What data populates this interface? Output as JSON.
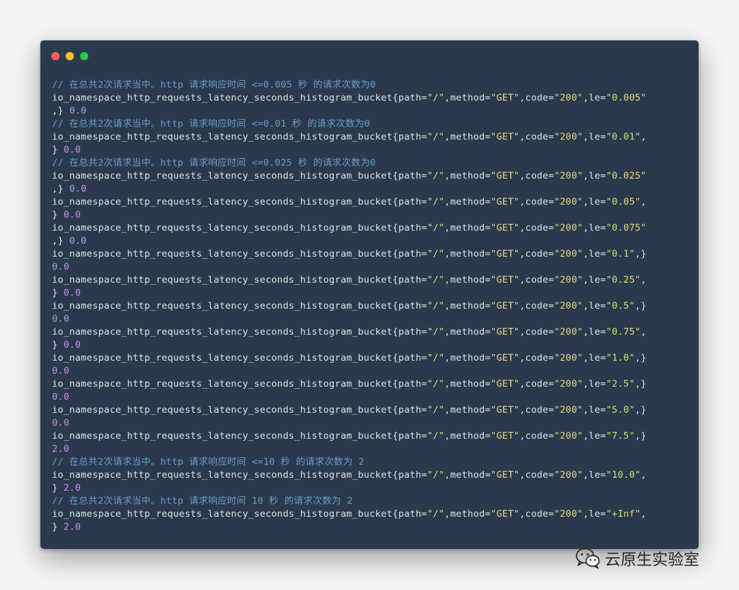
{
  "window": {
    "buttons": {
      "close": "#ff5f56",
      "minimize": "#ffbd2e",
      "zoom": "#27c93f"
    }
  },
  "code": {
    "metric": "io_namespace_http_requests_latency_seconds_histogram_bucket",
    "path_key": "path=",
    "path_value": "\"/\"",
    "method_key": ",method=",
    "method_value": "\"GET\"",
    "code_key": ",code=",
    "code_value": "\"200\"",
    "le_key": ",le=",
    "lines": [
      {
        "kind": "comment",
        "text": "// 在总共2次请求当中。http 请求响应时间 <=0.005 秒 的请求次数为0"
      },
      {
        "kind": "bucket",
        "le": "\"0.005\"",
        "tail": "",
        "wrap_prefix": ",} ",
        "value": "0.0"
      },
      {
        "kind": "comment",
        "text": "// 在总共2次请求当中。http 请求响应时间 <=0.01 秒 的请求次数为0"
      },
      {
        "kind": "bucket",
        "le": "\"0.01\"",
        "tail": ",",
        "wrap_prefix": "} ",
        "value": "0.0"
      },
      {
        "kind": "comment",
        "text": "// 在总共2次请求当中。http 请求响应时间 <=0.025 秒 的请求次数为0"
      },
      {
        "kind": "bucket",
        "le": "\"0.025\"",
        "tail": "",
        "wrap_prefix": ",} ",
        "value": "0.0"
      },
      {
        "kind": "bucket",
        "le": "\"0.05\"",
        "tail": ",",
        "wrap_prefix": "} ",
        "value": "0.0"
      },
      {
        "kind": "bucket",
        "le": "\"0.075\"",
        "tail": "",
        "wrap_prefix": ",} ",
        "value": "0.0"
      },
      {
        "kind": "bucket",
        "le": "\"0.1\"",
        "tail": ",}",
        "wrap_prefix": "",
        "value": "0.0"
      },
      {
        "kind": "bucket",
        "le": "\"0.25\"",
        "tail": ",",
        "wrap_prefix": "} ",
        "value": "0.0"
      },
      {
        "kind": "bucket",
        "le": "\"0.5\"",
        "tail": ",}",
        "wrap_prefix": "",
        "value": "0.0"
      },
      {
        "kind": "bucket",
        "le": "\"0.75\"",
        "tail": ",",
        "wrap_prefix": "} ",
        "value": "0.0"
      },
      {
        "kind": "bucket",
        "le": "\"1.0\"",
        "tail": ",}",
        "wrap_prefix": "",
        "value": "0.0"
      },
      {
        "kind": "bucket",
        "le": "\"2.5\"",
        "tail": ",}",
        "wrap_prefix": "",
        "value": "0.0"
      },
      {
        "kind": "bucket",
        "le": "\"5.0\"",
        "tail": ",}",
        "wrap_prefix": "",
        "value": "0.0"
      },
      {
        "kind": "bucket",
        "le": "\"7.5\"",
        "tail": ",}",
        "wrap_prefix": "",
        "value": "2.0"
      },
      {
        "kind": "comment",
        "text": "// 在总共2次请求当中。http 请求响应时间 <=10 秒 的请求次数为 2"
      },
      {
        "kind": "bucket",
        "le": "\"10.0\"",
        "tail": ",",
        "wrap_prefix": "} ",
        "value": "2.0"
      },
      {
        "kind": "comment",
        "text": "// 在总共2次请求当中。http 请求响应时间 10 秒 的请求次数为 2"
      },
      {
        "kind": "bucket",
        "le": "\"+Inf\"",
        "tail": ",",
        "wrap_prefix": "} ",
        "value": "2.0"
      }
    ]
  },
  "watermark": {
    "icon": "wechat-icon",
    "text": "云原生实验室"
  },
  "colors": {
    "background": "#2a3a4c",
    "comment": "#6a9bd0",
    "string": "#e6d97a",
    "number": "#c792ea",
    "text": "#dfe3e8"
  }
}
